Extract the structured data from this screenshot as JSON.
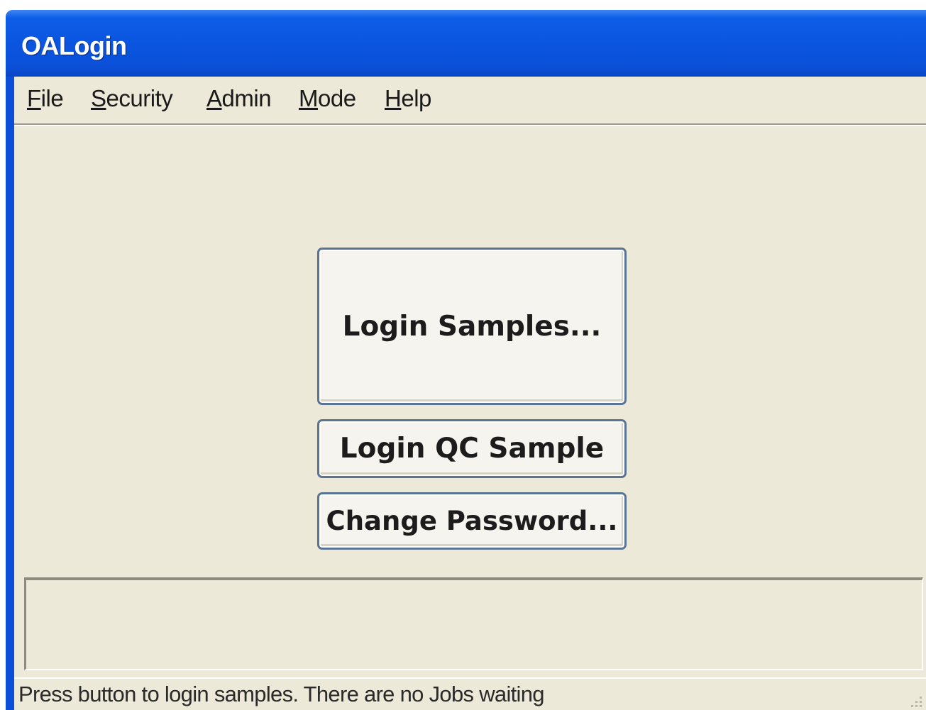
{
  "window": {
    "title": "OALogin"
  },
  "menu": [
    {
      "label": "File",
      "accel": "F",
      "rest": "ile"
    },
    {
      "label": "Security",
      "accel": "S",
      "rest": "ecurity"
    },
    {
      "label": "Admin",
      "accel": "A",
      "rest": "dmin"
    },
    {
      "label": "Mode",
      "accel": "M",
      "rest": "ode"
    },
    {
      "label": "Help",
      "accel": "H",
      "rest": "elp"
    }
  ],
  "buttons": {
    "login_samples": "Login Samples...",
    "login_qc_sample": "Login QC Sample",
    "change_password": "Change Password..."
  },
  "status": {
    "message": "Press button to login samples. There are no Jobs waiting"
  },
  "colors": {
    "titlebar": "#0a55e0",
    "face": "#ece9d8",
    "button_border": "#5a7496"
  }
}
